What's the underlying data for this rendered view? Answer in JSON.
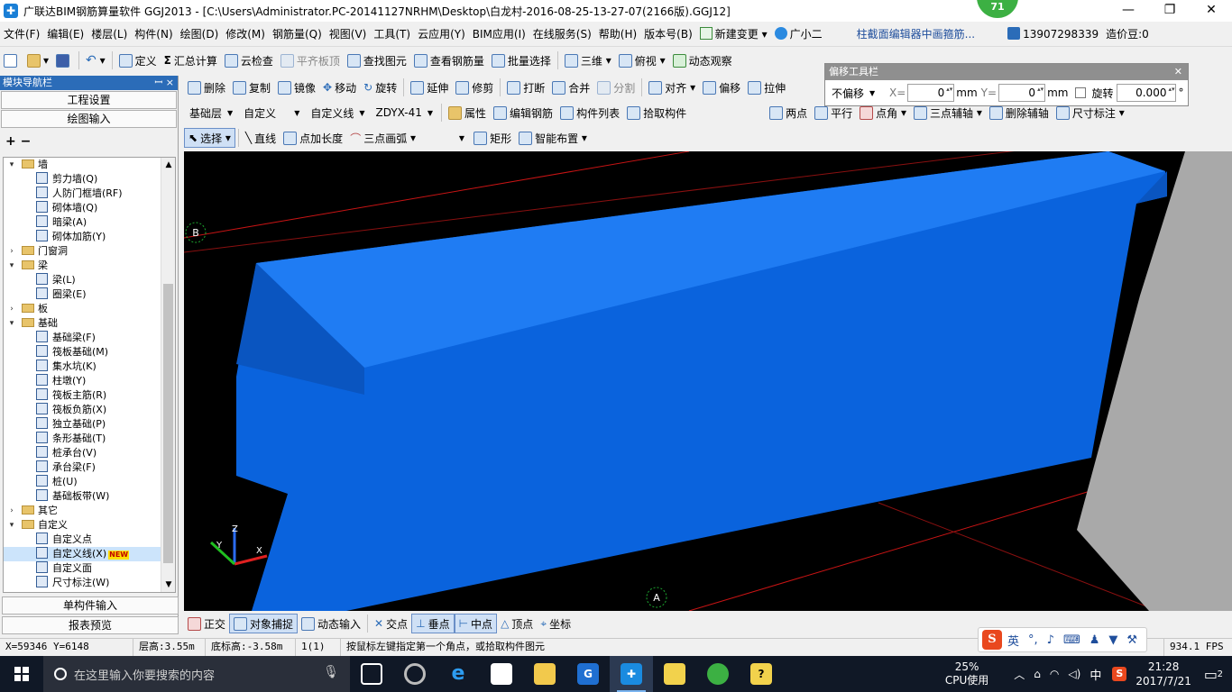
{
  "window": {
    "title": "广联达BIM钢筋算量软件 GGJ2013 - [C:\\Users\\Administrator.PC-20141127NRHM\\Desktop\\白龙村-2016-08-25-13-27-07(2166版).GGJ12]",
    "badge": "71",
    "minimize": "—",
    "restore": "❐",
    "close": "✕"
  },
  "menu": {
    "items": [
      "文件(F)",
      "编辑(E)",
      "楼层(L)",
      "构件(N)",
      "绘图(D)",
      "修改(M)",
      "钢筋量(Q)",
      "视图(V)",
      "工具(T)",
      "云应用(Y)",
      "BIM应用(I)",
      "在线服务(S)",
      "帮助(H)",
      "版本号(B)"
    ],
    "new_change": "新建变更",
    "assistant": "广小二",
    "notice": "柱截面编辑器中画箍筋...",
    "phone": "13907298339",
    "price_bean": "造价豆:0"
  },
  "toolbar1": [
    "定义",
    "汇总计算",
    "云检查",
    "平齐板顶",
    "查找图元",
    "查看钢筋量",
    "批量选择",
    "三维",
    "俯视",
    "动态观察"
  ],
  "toolbar2": [
    "删除",
    "复制",
    "镜像",
    "移动",
    "旋转",
    "延伸",
    "修剪",
    "打断",
    "合并",
    "分割",
    "对齐",
    "偏移",
    "拉伸"
  ],
  "toolbar3": {
    "layer": "基础层",
    "category": "自定义",
    "type": "自定义线",
    "component": "ZDYX-41",
    "buttons": [
      "属性",
      "编辑钢筋",
      "构件列表",
      "拾取构件"
    ],
    "axis_buttons": [
      "两点",
      "平行",
      "点角",
      "三点辅轴",
      "删除辅轴",
      "尺寸标注"
    ]
  },
  "toolbar4": {
    "select": "选择",
    "buttons": [
      "直线",
      "点加长度",
      "三点画弧",
      "矩形",
      "智能布置"
    ]
  },
  "offset_panel": {
    "title": "偏移工具栏",
    "mode": "不偏移",
    "x_label": "X=",
    "x_value": "0",
    "y_label": "Y=",
    "y_value": "0",
    "unit": "mm",
    "rotate_label": "旋转",
    "rotate_value": "0.000",
    "degree": "°"
  },
  "nav": {
    "title": "模块导航栏",
    "pin": "ꟷ ×",
    "btn_settings": "工程设置",
    "btn_draw": "绘图输入",
    "tools": "+ −",
    "tree": [
      {
        "level": 0,
        "toggle": "▾",
        "label": "墙",
        "folder": true
      },
      {
        "level": 1,
        "label": "剪力墙(Q)"
      },
      {
        "level": 1,
        "label": "人防门框墙(RF)"
      },
      {
        "level": 1,
        "label": "砌体墙(Q)"
      },
      {
        "level": 1,
        "label": "暗梁(A)"
      },
      {
        "level": 1,
        "label": "砌体加筋(Y)"
      },
      {
        "level": 0,
        "toggle": "›",
        "label": "门窗洞",
        "folder": true
      },
      {
        "level": 0,
        "toggle": "▾",
        "label": "梁",
        "folder": true
      },
      {
        "level": 1,
        "label": "梁(L)"
      },
      {
        "level": 1,
        "label": "圈梁(E)"
      },
      {
        "level": 0,
        "toggle": "›",
        "label": "板",
        "folder": true
      },
      {
        "level": 0,
        "toggle": "▾",
        "label": "基础",
        "folder": true
      },
      {
        "level": 1,
        "label": "基础梁(F)"
      },
      {
        "level": 1,
        "label": "筏板基础(M)"
      },
      {
        "level": 1,
        "label": "集水坑(K)"
      },
      {
        "level": 1,
        "label": "柱墩(Y)"
      },
      {
        "level": 1,
        "label": "筏板主筋(R)"
      },
      {
        "level": 1,
        "label": "筏板负筋(X)"
      },
      {
        "level": 1,
        "label": "独立基础(P)"
      },
      {
        "level": 1,
        "label": "条形基础(T)"
      },
      {
        "level": 1,
        "label": "桩承台(V)"
      },
      {
        "level": 1,
        "label": "承台梁(F)"
      },
      {
        "level": 1,
        "label": "桩(U)"
      },
      {
        "level": 1,
        "label": "基础板带(W)"
      },
      {
        "level": 0,
        "toggle": "›",
        "label": "其它",
        "folder": true
      },
      {
        "level": 0,
        "toggle": "▾",
        "label": "自定义",
        "folder": true
      },
      {
        "level": 1,
        "label": "自定义点"
      },
      {
        "level": 1,
        "label": "自定义线(X)",
        "selected": true,
        "newtag": "NEW"
      },
      {
        "level": 1,
        "label": "自定义面"
      },
      {
        "level": 1,
        "label": "尺寸标注(W)"
      }
    ],
    "btn_single": "单构件输入",
    "btn_report": "报表预览"
  },
  "viewport": {
    "axis_b": "B",
    "axis_a": "A",
    "axis_x": "X",
    "axis_y": "Y",
    "axis_z": "Z"
  },
  "snapbar": [
    "正交",
    "对象捕捉",
    "动态输入",
    "交点",
    "垂点",
    "中点",
    "顶点",
    "坐标"
  ],
  "status": {
    "coords": "X=59346 Y=6148",
    "floor_height": "层高:3.55m",
    "bottom_elev": "底标高:-3.58m",
    "count": "1(1)",
    "hint": "按鼠标左键指定第一个角点，或拾取构件图元",
    "fps": "934.1 FPS"
  },
  "ime": {
    "logo": "S",
    "lang": "英"
  },
  "taskbar": {
    "search_placeholder": "在这里输入你要搜索的内容",
    "cpu_pct": "25%",
    "cpu_label": "CPU使用",
    "ime_lang": "中",
    "time": "21:28",
    "date": "2017/7/21",
    "notif_count": "2"
  },
  "colors": {
    "beam_front": "#0a63dd",
    "beam_top": "#1f7cf3",
    "beam_side": "#0a55c0",
    "grid_line": "#cc1010",
    "wall_gray": "#a9a9a9"
  }
}
